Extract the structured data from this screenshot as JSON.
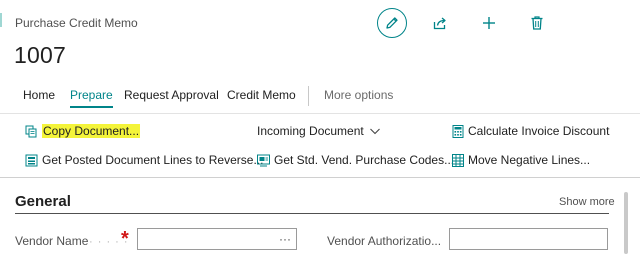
{
  "header": {
    "page_type": "Purchase Credit Memo",
    "record_no": "1007"
  },
  "toolbar": {
    "edit": "edit-icon",
    "share": "share-icon",
    "new": "plus-icon",
    "delete": "trash-icon"
  },
  "tabs": [
    {
      "label": "Home"
    },
    {
      "label": "Prepare",
      "active": true
    },
    {
      "label": "Request Approval"
    },
    {
      "label": "Credit Memo"
    },
    {
      "label": "More options"
    }
  ],
  "actions": {
    "copy_document": "Copy Document...",
    "incoming_document": "Incoming Document",
    "calc_invoice_discount": "Calculate Invoice Discount",
    "get_posted_lines": "Get Posted Document Lines to Reverse...",
    "get_std_codes": "Get Std. Vend. Purchase Codes...",
    "move_negative_lines": "Move Negative Lines..."
  },
  "general": {
    "title": "General",
    "show_more": "Show more",
    "vendor_name_label": "Vendor Name",
    "vendor_name_value": "",
    "vendor_auth_label": "Vendor Authorizatio...",
    "vendor_auth_value": "",
    "lookup": "···"
  },
  "colors": {
    "accent": "#008489",
    "highlight": "#f4f43a",
    "required": "#d11717"
  }
}
